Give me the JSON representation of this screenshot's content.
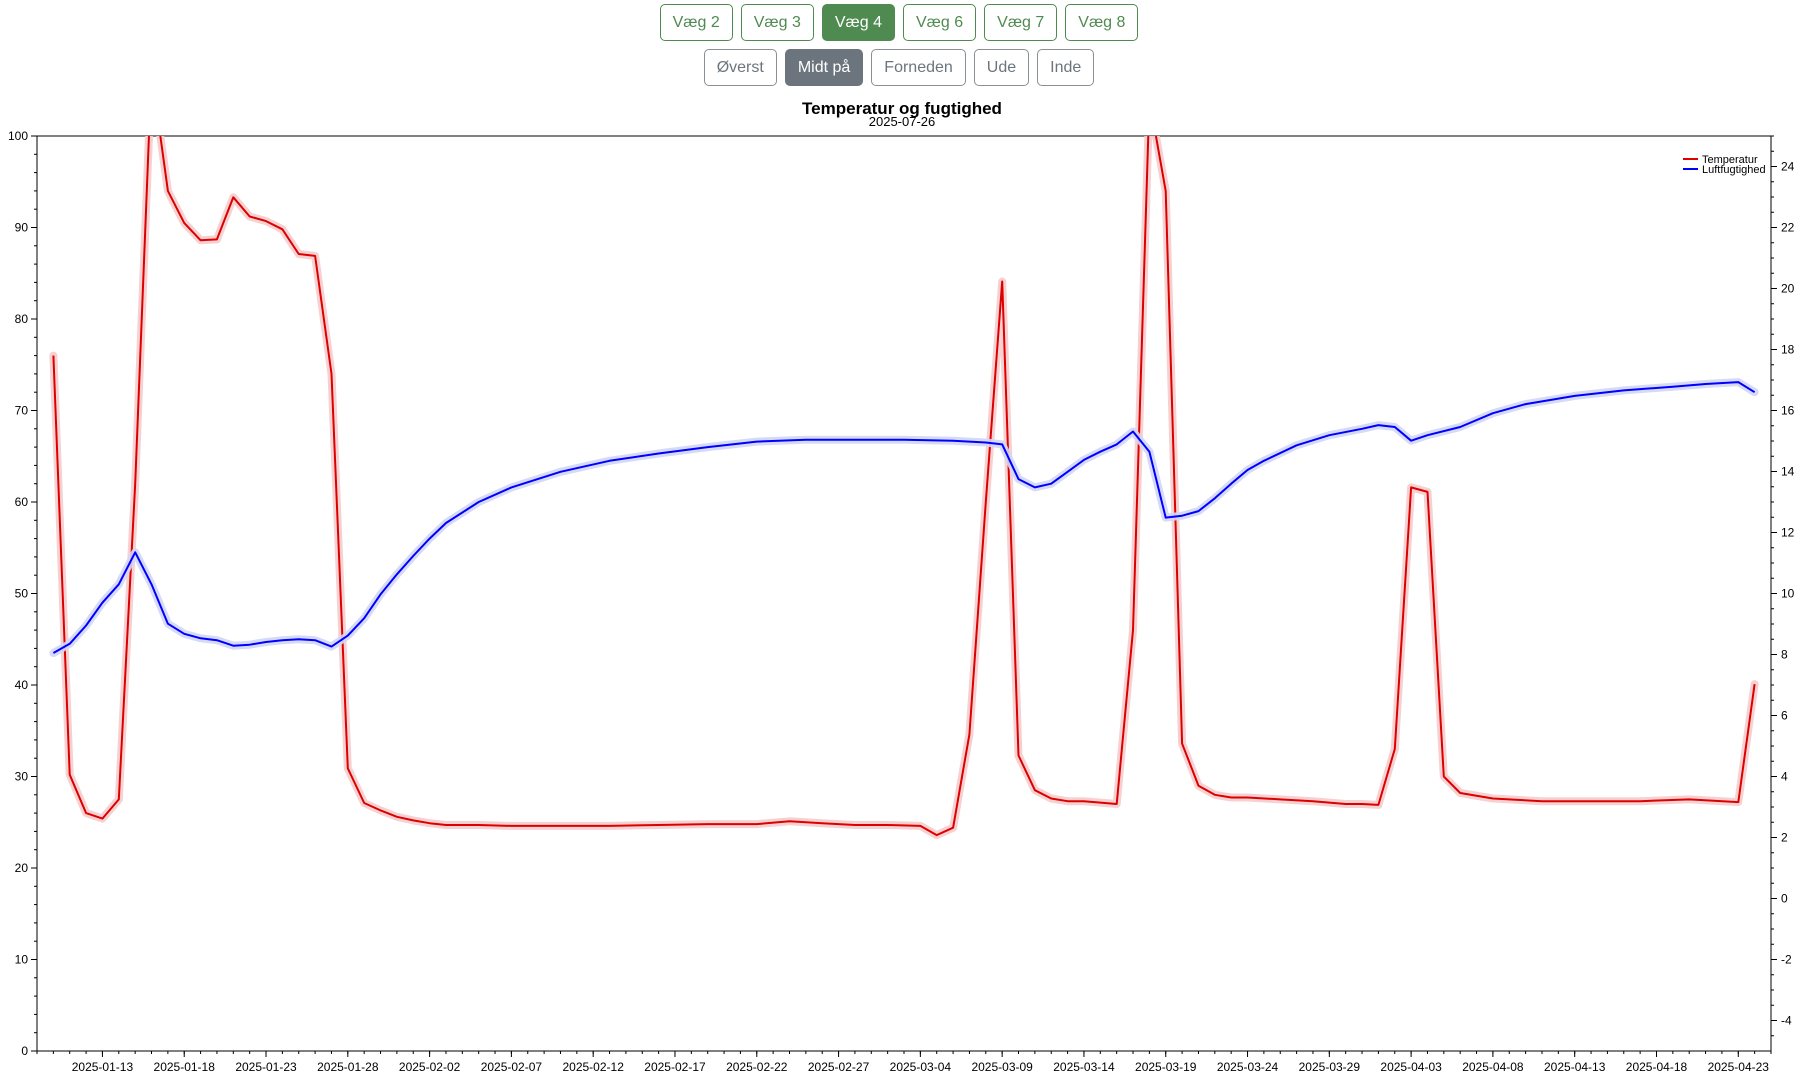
{
  "walls": {
    "selected": "Væg 4",
    "items": [
      "Væg 2",
      "Væg 3",
      "Væg 4",
      "Væg 6",
      "Væg 7",
      "Væg 8"
    ]
  },
  "positions": {
    "selected": "Midt på",
    "items": [
      "Øverst",
      "Midt på",
      "Forneden",
      "Ude",
      "Inde"
    ]
  },
  "chart_data": {
    "type": "line",
    "title": "Temperatur og fugtighed",
    "subtitle": "2025-07-26",
    "x_axis": {
      "type": "date",
      "range": [
        "2025-01-09",
        "2025-04-25"
      ],
      "ticks": [
        "2025-01-13",
        "2025-01-18",
        "2025-01-23",
        "2025-01-28",
        "2025-02-02",
        "2025-02-07",
        "2025-02-12",
        "2025-02-17",
        "2025-02-22",
        "2025-02-27",
        "2025-03-04",
        "2025-03-09",
        "2025-03-14",
        "2025-03-19",
        "2025-03-24",
        "2025-03-29",
        "2025-04-03",
        "2025-04-08",
        "2025-04-13",
        "2025-04-18",
        "2025-04-23"
      ]
    },
    "y_left": {
      "range": [
        0,
        100
      ],
      "ticks": [
        0,
        10,
        20,
        30,
        40,
        50,
        60,
        70,
        80,
        90,
        100
      ]
    },
    "y_right": {
      "range": [
        -5,
        25
      ],
      "ticks": [
        -4,
        -2,
        0,
        2,
        4,
        6,
        8,
        10,
        12,
        14,
        16,
        18,
        20,
        22,
        24
      ]
    },
    "legend": {
      "placement": "top-right"
    },
    "series": [
      {
        "name": "Temperatur",
        "color": "#dd0000",
        "band_color": "#f6cccc",
        "axis": "left",
        "x": [
          "2025-01-10",
          "2025-01-11",
          "2025-01-12",
          "2025-01-13",
          "2025-01-14",
          "2025-01-15",
          "2025-01-16",
          "2025-01-17",
          "2025-01-18",
          "2025-01-19",
          "2025-01-20",
          "2025-01-21",
          "2025-01-22",
          "2025-01-23",
          "2025-01-24",
          "2025-01-25",
          "2025-01-26",
          "2025-01-27",
          "2025-01-28",
          "2025-01-29",
          "2025-01-30",
          "2025-01-31",
          "2025-02-01",
          "2025-02-02",
          "2025-02-03",
          "2025-02-05",
          "2025-02-07",
          "2025-02-10",
          "2025-02-13",
          "2025-02-16",
          "2025-02-19",
          "2025-02-22",
          "2025-02-24",
          "2025-02-26",
          "2025-02-28",
          "2025-03-02",
          "2025-03-04",
          "2025-03-05",
          "2025-03-06",
          "2025-03-07",
          "2025-03-08",
          "2025-03-09",
          "2025-03-10",
          "2025-03-11",
          "2025-03-12",
          "2025-03-13",
          "2025-03-14",
          "2025-03-16",
          "2025-03-17",
          "2025-03-18",
          "2025-03-19",
          "2025-03-20",
          "2025-03-21",
          "2025-03-22",
          "2025-03-23",
          "2025-03-24",
          "2025-03-26",
          "2025-03-28",
          "2025-03-30",
          "2025-03-31",
          "2025-04-01",
          "2025-04-02",
          "2025-04-03",
          "2025-04-04",
          "2025-04-05",
          "2025-04-06",
          "2025-04-08",
          "2025-04-11",
          "2025-04-14",
          "2025-04-17",
          "2025-04-20",
          "2025-04-23",
          "2025-04-24"
        ],
        "y": [
          76,
          30.2,
          26,
          25.4,
          27.5,
          62,
          107,
          94,
          90.5,
          88.6,
          88.7,
          93.3,
          91.2,
          90.7,
          89.8,
          87.1,
          86.9,
          74,
          30.9,
          27.1,
          26.3,
          25.6,
          25.2,
          24.9,
          24.7,
          24.7,
          24.6,
          24.6,
          24.6,
          24.7,
          24.8,
          24.8,
          25.1,
          24.9,
          24.7,
          24.7,
          24.6,
          23.6,
          24.4,
          34.6,
          60,
          84.1,
          32.3,
          28.5,
          27.6,
          27.3,
          27.3,
          27,
          46,
          104,
          94,
          33.6,
          29,
          28,
          27.7,
          27.7,
          27.5,
          27.3,
          27,
          27,
          26.9,
          33,
          61.6,
          61.1,
          30,
          28.2,
          27.6,
          27.3,
          27.3,
          27.3,
          27.5,
          27.2,
          40.1
        ]
      },
      {
        "name": "Luftfugtighed",
        "color": "#0000ff",
        "band_color": "#d2d6f6",
        "axis": "left",
        "x": [
          "2025-01-10",
          "2025-01-11",
          "2025-01-12",
          "2025-01-13",
          "2025-01-14",
          "2025-01-15",
          "2025-01-16",
          "2025-01-17",
          "2025-01-18",
          "2025-01-19",
          "2025-01-20",
          "2025-01-21",
          "2025-01-22",
          "2025-01-23",
          "2025-01-24",
          "2025-01-25",
          "2025-01-26",
          "2025-01-27",
          "2025-01-28",
          "2025-01-29",
          "2025-01-30",
          "2025-01-31",
          "2025-02-01",
          "2025-02-02",
          "2025-02-03",
          "2025-02-05",
          "2025-02-07",
          "2025-02-10",
          "2025-02-13",
          "2025-02-16",
          "2025-02-19",
          "2025-02-22",
          "2025-02-25",
          "2025-02-28",
          "2025-03-03",
          "2025-03-06",
          "2025-03-08",
          "2025-03-09",
          "2025-03-10",
          "2025-03-11",
          "2025-03-12",
          "2025-03-13",
          "2025-03-14",
          "2025-03-15",
          "2025-03-16",
          "2025-03-17",
          "2025-03-18",
          "2025-03-19",
          "2025-03-20",
          "2025-03-21",
          "2025-03-22",
          "2025-03-23",
          "2025-03-24",
          "2025-03-25",
          "2025-03-27",
          "2025-03-29",
          "2025-03-31",
          "2025-04-01",
          "2025-04-02",
          "2025-04-03",
          "2025-04-04",
          "2025-04-06",
          "2025-04-08",
          "2025-04-10",
          "2025-04-13",
          "2025-04-16",
          "2025-04-19",
          "2025-04-21",
          "2025-04-23",
          "2025-04-24"
        ],
        "y": [
          43.5,
          44.5,
          46.5,
          49,
          51,
          54.5,
          51,
          46.7,
          45.6,
          45.1,
          44.9,
          44.3,
          44.4,
          44.7,
          44.9,
          45,
          44.9,
          44.2,
          45.4,
          47.3,
          49.9,
          52.1,
          54.1,
          56,
          57.7,
          60,
          61.6,
          63.3,
          64.5,
          65.3,
          66,
          66.6,
          66.8,
          66.8,
          66.8,
          66.7,
          66.5,
          66.3,
          62.5,
          61.6,
          62,
          63.3,
          64.6,
          65.5,
          66.3,
          67.7,
          65.5,
          58.3,
          58.5,
          59,
          60.4,
          62,
          63.5,
          64.5,
          66.2,
          67.3,
          68,
          68.4,
          68.2,
          66.7,
          67.3,
          68.2,
          69.7,
          70.7,
          71.6,
          72.2,
          72.6,
          72.9,
          73.1,
          72
        ]
      }
    ]
  }
}
